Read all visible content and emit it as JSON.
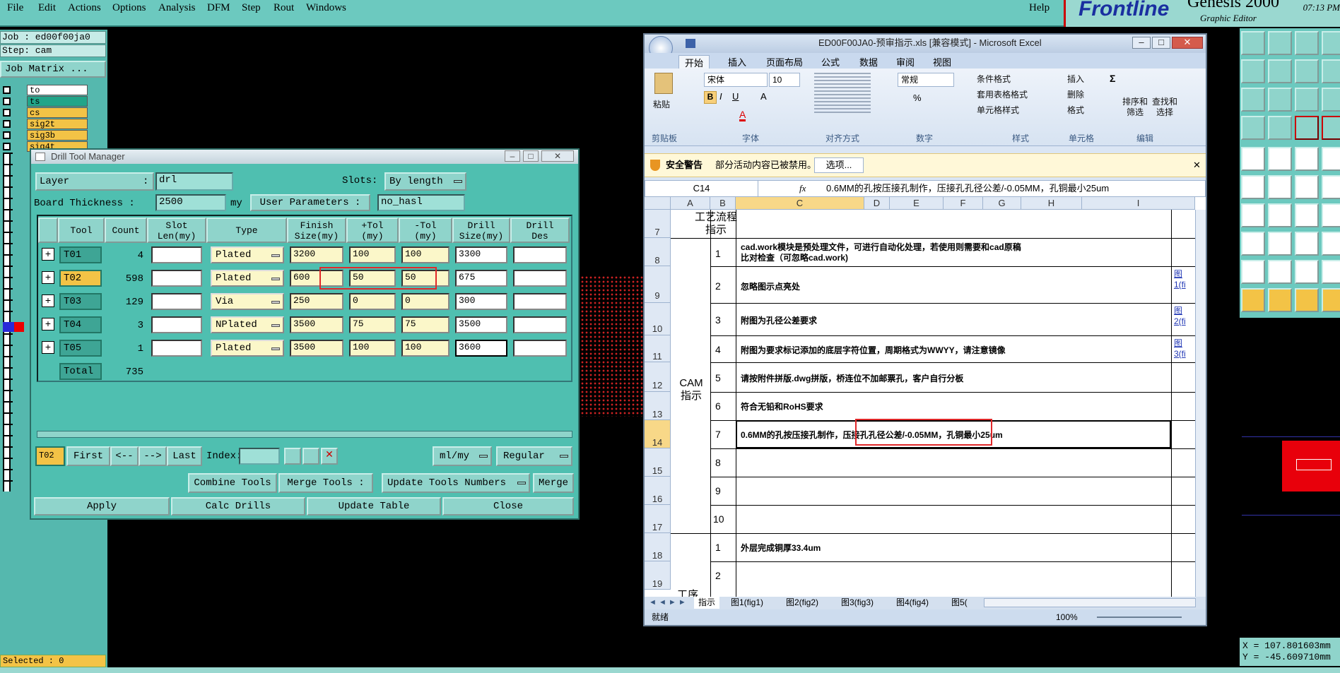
{
  "menubar": {
    "items": [
      "File",
      "Edit",
      "Actions",
      "Options",
      "Analysis",
      "DFM",
      "Step",
      "Rout",
      "Windows"
    ],
    "help": "Help"
  },
  "logo": {
    "brand": "Frontline",
    "product": "Genesis 2000",
    "subtitle": "Graphic Editor",
    "time": "07:13 PM"
  },
  "left_panel": {
    "job": "Job : ed00f00ja0",
    "step": "Step: cam",
    "job_matrix": "Job Matrix ...",
    "layers": [
      {
        "name": "to",
        "color": "#ffffff"
      },
      {
        "name": "ts",
        "color": "#21a589"
      },
      {
        "name": "cs",
        "color": "#f3c346"
      },
      {
        "name": "sig2t",
        "color": "#f3c346"
      },
      {
        "name": "sig3b",
        "color": "#f3c346"
      },
      {
        "name": "sig4t",
        "color": "#f3c346"
      }
    ],
    "selected": "Selected : 0"
  },
  "drill_tool_manager": {
    "title": "Drill Tool Manager",
    "layer_label": "Layer",
    "layer_value": "drl",
    "slots_label": "Slots:",
    "slots_value": "By length",
    "board_thickness_label": "Board Thickness :",
    "board_thickness_value": "2500",
    "board_unit": "my",
    "user_params_label": "User Parameters :",
    "user_params_value": "no_hasl",
    "columns": [
      "Tool",
      "Count",
      "Slot\nLen(my)",
      "Type",
      "Finish\nSize(my)",
      "+Tol\n(my)",
      "-Tol\n(my)",
      "Drill\nSize(my)",
      "Drill\nDes"
    ],
    "rows": [
      {
        "tool": "T01",
        "count": "4",
        "type": "Plated",
        "finish": "3200",
        "ptol": "100",
        "mtol": "100",
        "drill": "3300"
      },
      {
        "tool": "T02",
        "count": "598",
        "type": "Plated",
        "finish": "600",
        "ptol": "50",
        "mtol": "50",
        "drill": "675"
      },
      {
        "tool": "T03",
        "count": "129",
        "type": "Via",
        "finish": "250",
        "ptol": "0",
        "mtol": "0",
        "drill": "300"
      },
      {
        "tool": "T04",
        "count": "3",
        "type": "NPlated",
        "finish": "3500",
        "ptol": "75",
        "mtol": "75",
        "drill": "3500"
      },
      {
        "tool": "T05",
        "count": "1",
        "type": "Plated",
        "finish": "3500",
        "ptol": "100",
        "mtol": "100",
        "drill": "3600"
      }
    ],
    "total_label": "Total",
    "total_value": "735",
    "nav": {
      "current": "T02",
      "first": "First",
      "prev": "<--",
      "next": "-->",
      "last": "Last",
      "index_label": "Index:",
      "units": "ml/my",
      "mode": "Regular"
    },
    "combine_tools": "Combine Tools",
    "merge_tools_label": "Merge Tools :",
    "merge_tools_value": "Update Tools Numbers",
    "merge": "Merge",
    "apply": "Apply",
    "calc_drills": "Calc Drills",
    "update_table": "Update Table",
    "close": "Close"
  },
  "excel": {
    "title": "ED00F00JA0-预审指示.xls [兼容模式] - Microsoft Excel",
    "tabs": [
      "开始",
      "插入",
      "页面布局",
      "公式",
      "数据",
      "审阅",
      "视图"
    ],
    "ribbon": {
      "paste": "粘贴",
      "clipboard": "剪贴板",
      "font_name": "宋体",
      "font_size": "10",
      "font_group": "字体",
      "align_group": "对齐方式",
      "number_format": "常规",
      "number_group": "数字",
      "cond_format": "条件格式",
      "table_format": "套用表格格式",
      "cell_style": "单元格样式",
      "style_group": "样式",
      "insert": "插入",
      "delete": "删除",
      "format": "格式",
      "cells_group": "单元格",
      "sort_filter": "排序和\n筛选",
      "find_select": "查找和\n选择",
      "edit_group": "编辑"
    },
    "security": {
      "label": "安全警告",
      "message": "部分活动内容已被禁用。",
      "button": "选项..."
    },
    "name_box": "C14",
    "formula": "0.6MM的孔按压接孔制作，压接孔孔径公差/-0.05MM，孔铜最小25um",
    "col_headers": [
      "A",
      "B",
      "C",
      "D",
      "E",
      "F",
      "G",
      "H",
      "I"
    ],
    "row_headers": [
      "7",
      "8",
      "9",
      "10",
      "11",
      "12",
      "13",
      "14",
      "15",
      "16",
      "17",
      "18",
      "19"
    ],
    "section_title": "工艺流程\n指示",
    "section_cam": "CAM\n指示",
    "section_bottom": "工序",
    "rows": [
      {
        "num": "1",
        "text": "cad.work模块是预处理文件，可进行自动化处理，若使用则需要和cad原稿比对检查（可忽略cad.work)",
        "link": ""
      },
      {
        "num": "2",
        "text": "忽略图示点亮处",
        "link": "图1(fi"
      },
      {
        "num": "3",
        "text": "附图为孔径公差要求",
        "link": "图2(fi"
      },
      {
        "num": "4",
        "text": "附图为要求标记添加的底层字符位置，周期格式为WWYY，请注意镜像",
        "link": "图3(fi"
      },
      {
        "num": "5",
        "text": "请按附件拼版.dwg拼版，桥连位不加邮票孔，客户自行分板",
        "link": ""
      },
      {
        "num": "6",
        "text": "符合无铅和RoHS要求",
        "link": ""
      },
      {
        "num": "7",
        "text": "0.6MM的孔按压接孔制作，压接孔孔径公差/-0.05MM，孔铜最小25um",
        "link": ""
      },
      {
        "num": "8",
        "text": "",
        "link": ""
      },
      {
        "num": "9",
        "text": "",
        "link": ""
      },
      {
        "num": "10",
        "text": "",
        "link": ""
      },
      {
        "num": "1",
        "text": "外层完成铜厚33.4um",
        "link": ""
      },
      {
        "num": "2",
        "text": "",
        "link": ""
      }
    ],
    "sheet_tabs": [
      "指示",
      "图1(fig1)",
      "图2(fig2)",
      "图3(fig3)",
      "图4(fig4)",
      "图5("
    ],
    "status": "就绪",
    "zoom": "100%"
  },
  "coords": {
    "x": "X = 107.801603mm",
    "y": "Y = -45.609710mm"
  }
}
